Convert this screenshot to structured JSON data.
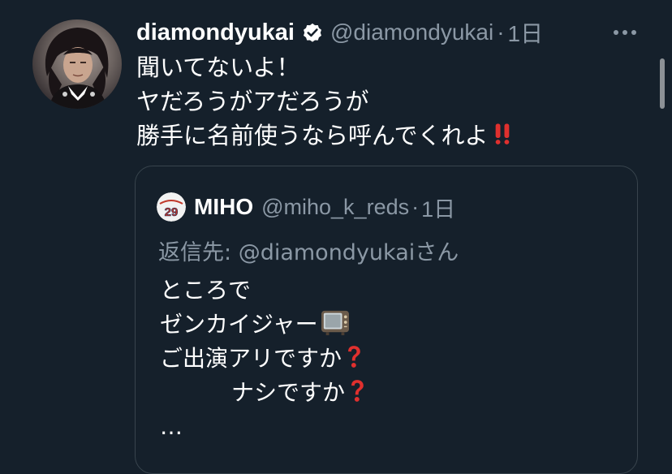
{
  "tweet": {
    "display_name": "diamondyukai",
    "handle": "@diamondyukai",
    "separator": "·",
    "time": "1日",
    "lines": [
      "聞いてないよ！",
      "ヤだろうがアだろうが",
      "勝手に名前使うなら呼んでくれよ"
    ],
    "trailing_emoji": "double-exclamation-icon"
  },
  "quote": {
    "display_name": "MIHO",
    "handle": "@miho_k_reds",
    "separator": "·",
    "time": "1日",
    "avatar_number": "29",
    "reply_prefix": "返信先: ",
    "reply_mention": "@diamondyukai",
    "reply_suffix": "さん",
    "lines": [
      "ところで",
      "ゼンカイジャー",
      "ご出演アリですか",
      "ナシですか",
      "…"
    ],
    "icons": [
      "television-icon",
      "question-mark-icon"
    ]
  },
  "colors": {
    "background": "#15202b",
    "primary_text": "#ffffff",
    "secondary_text": "#8b98a5",
    "border": "#38444d",
    "verified_badge": "#ffffff",
    "emoji_red": "#e0302e"
  }
}
